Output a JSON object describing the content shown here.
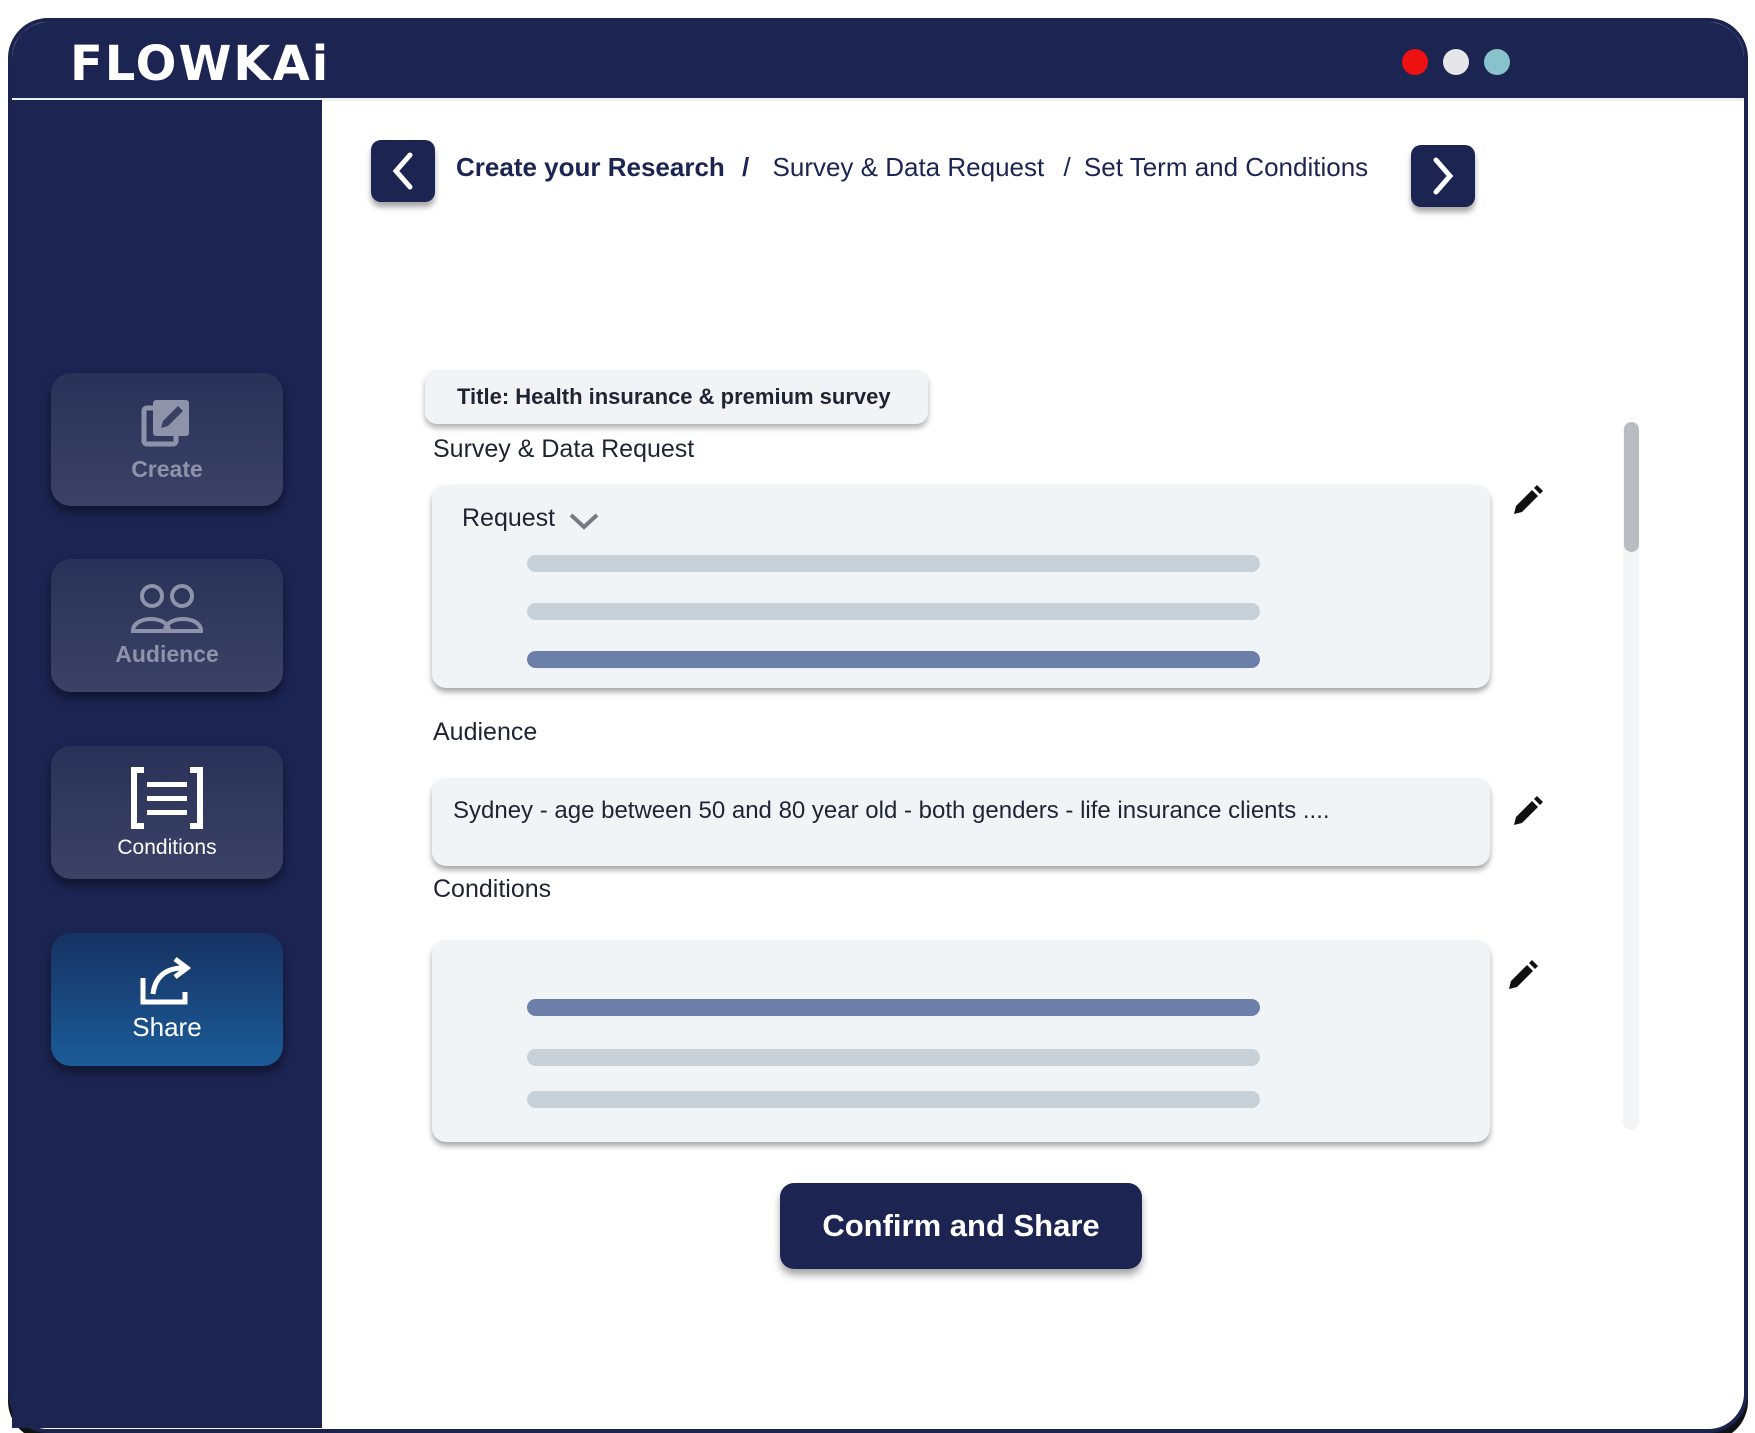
{
  "app": {
    "logo": "FLOWKAi"
  },
  "window_controls": {
    "colors": [
      "#ee1111",
      "#e4e6ea",
      "#88c2cb"
    ]
  },
  "sidebar": {
    "items": [
      {
        "label": "Create",
        "icon": "edit-icon"
      },
      {
        "label": "Audience",
        "icon": "users-icon"
      },
      {
        "label": "Conditions",
        "icon": "document-icon"
      },
      {
        "label": "Share",
        "icon": "share-icon",
        "active": true
      }
    ]
  },
  "breadcrumb": {
    "step1": "Create your Research",
    "sep1": "/",
    "step2": "Survey & Data Request",
    "sep2": "/",
    "step3": "Set Term and Conditions"
  },
  "main": {
    "title_chip": "Title: Health insurance & premium survey",
    "survey_section_label": "Survey & Data Request",
    "request_dropdown_label": "Request",
    "audience_section_label": "Audience",
    "audience_text": "Sydney - age between 50 and 80 year old - both genders - life insurance clients ....",
    "conditions_section_label": "Conditions",
    "confirm_button": "Confirm and Share"
  },
  "colors": {
    "primary": "#1c2452",
    "active_tab": "#1b5c98",
    "placeholder_bar": "#c8d0d8",
    "highlight_bar": "#6c7fa8"
  }
}
